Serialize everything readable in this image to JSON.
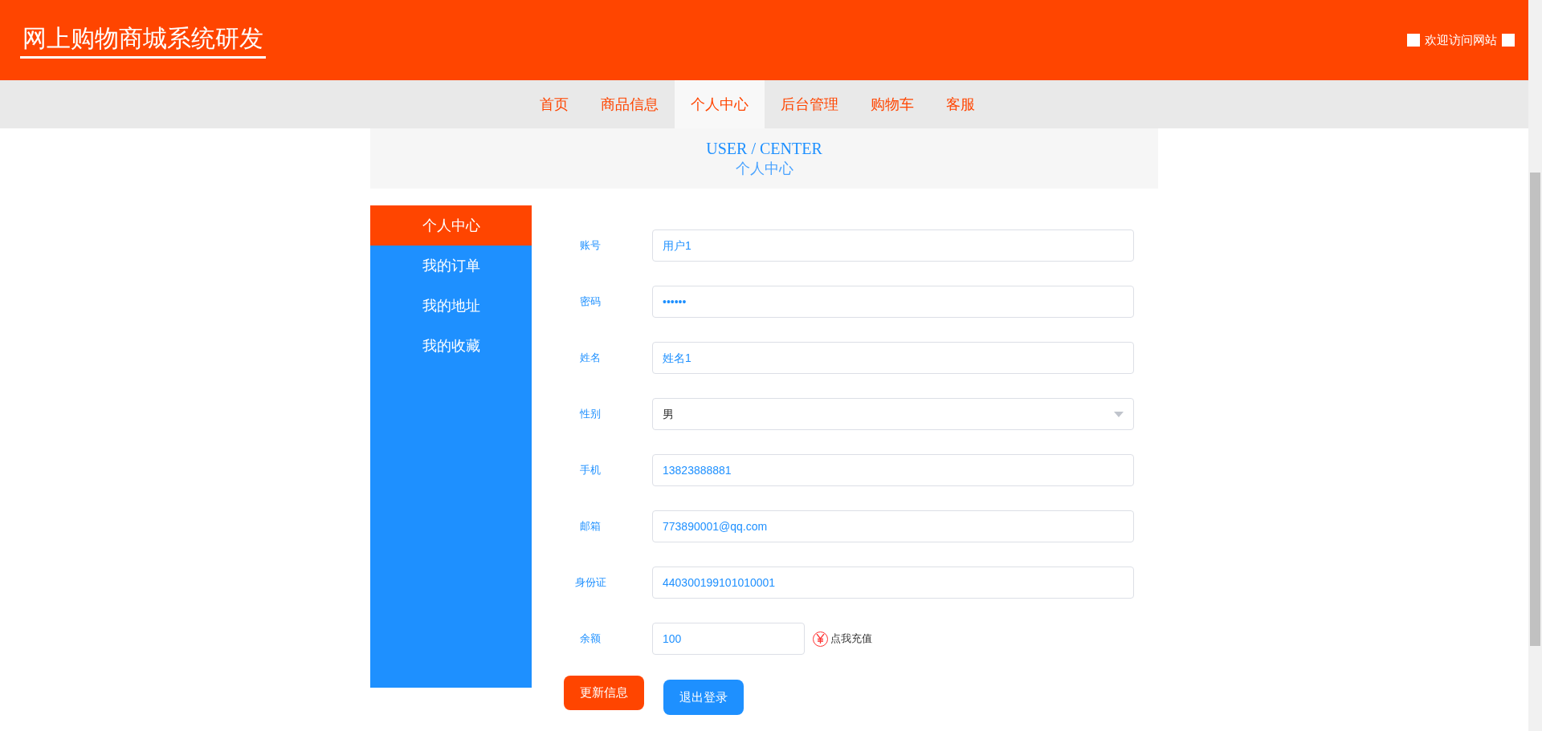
{
  "header": {
    "title": "网上购物商城系统研发",
    "welcome": "欢迎访问网站"
  },
  "nav": [
    {
      "label": "首页",
      "selected": false
    },
    {
      "label": "商品信息",
      "selected": false
    },
    {
      "label": "个人中心",
      "selected": true
    },
    {
      "label": "后台管理",
      "selected": false
    },
    {
      "label": "购物车",
      "selected": false
    },
    {
      "label": "客服",
      "selected": false
    }
  ],
  "banner": {
    "english": "USER / CENTER",
    "chinese": "个人中心"
  },
  "sidebar": [
    {
      "label": "个人中心",
      "selected": true
    },
    {
      "label": "我的订单",
      "selected": false
    },
    {
      "label": "我的地址",
      "selected": false
    },
    {
      "label": "我的收藏",
      "selected": false
    }
  ],
  "form": {
    "fields": [
      {
        "label": "账号",
        "value": "用户1",
        "kind": "text"
      },
      {
        "label": "密码",
        "value": "••••••",
        "kind": "text"
      },
      {
        "label": "姓名",
        "value": "姓名1",
        "kind": "text"
      },
      {
        "label": "性别",
        "value": "男",
        "kind": "select"
      },
      {
        "label": "手机",
        "value": "13823888881",
        "kind": "text"
      },
      {
        "label": "邮箱",
        "value": "773890001@qq.com",
        "kind": "text"
      },
      {
        "label": "身份证",
        "value": "440300199101010001",
        "kind": "text"
      },
      {
        "label": "余额",
        "value": "100",
        "kind": "balance",
        "action": "点我充值"
      }
    ],
    "buttons": [
      {
        "label": "更新信息",
        "kind": "primary"
      },
      {
        "label": "退出登录",
        "kind": "secondary"
      }
    ]
  }
}
